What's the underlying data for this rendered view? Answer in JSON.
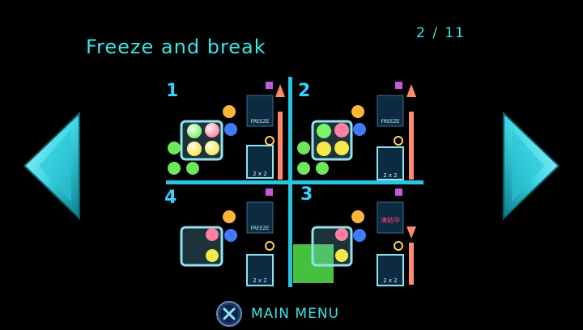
{
  "header": {
    "title": "Freeze and break",
    "page_indicator": "2 / 11"
  },
  "navigation": {
    "prev_icon": "left-triangle-arrow-icon",
    "next_icon": "right-triangle-arrow-icon"
  },
  "tutorial": {
    "quadrant_labels": [
      "1",
      "2",
      "4",
      "3"
    ],
    "panel_labels": {
      "freeze": "FREEZE",
      "chain_count": "2 x 2",
      "locked_kanji": "凍結中"
    }
  },
  "footer": {
    "menu_label": "MAIN MENU",
    "button_icon": "cross-button-icon"
  },
  "colors": {
    "accent": "#35e6e6",
    "divider": "#29c4e0",
    "arrow_up": "#ff8a6a",
    "background": "#000000"
  }
}
